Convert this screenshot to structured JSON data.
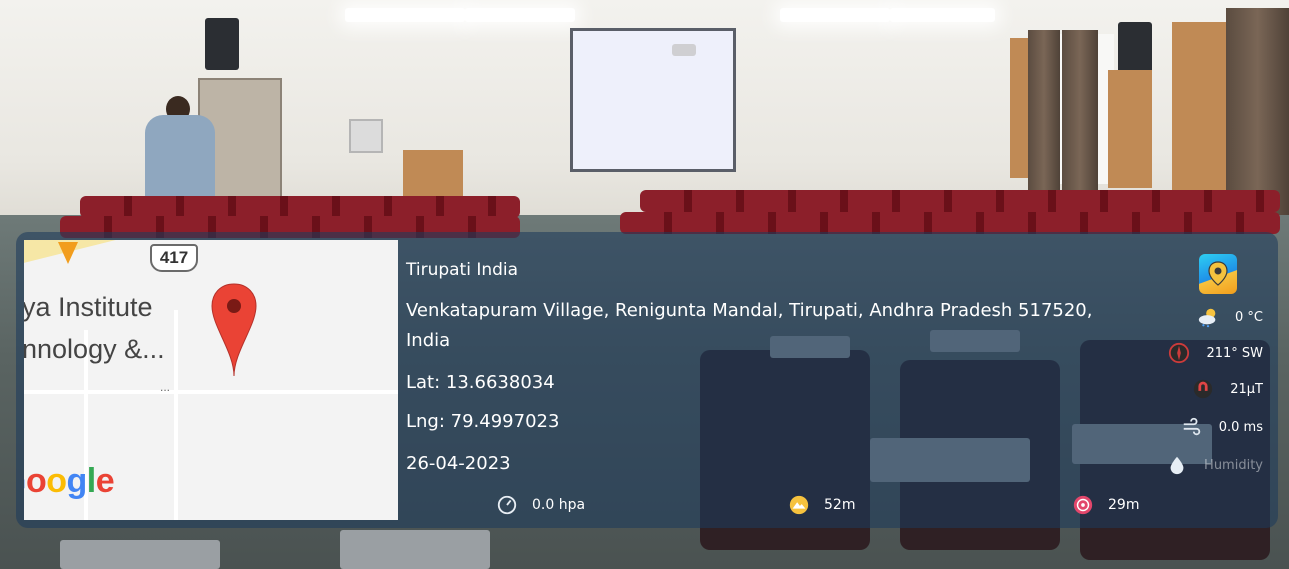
{
  "location": {
    "city_country": "Tirupati India",
    "address_line1": "Venkatapuram Village, Renigunta Mandal, Tirupati, Andhra Pradesh 517520,",
    "address_line2": "India",
    "lat": "Lat: 13.6638034",
    "lng": "Lng: 79.4997023",
    "date": "26-04-2023"
  },
  "map": {
    "route_shield": "417",
    "place_label_1": "ya Institute",
    "place_label_2": "nnology &...",
    "ellipsis": "...",
    "logo_text": "Google",
    "logo_colors": [
      "#4285F4",
      "#EA4335",
      "#FBBC05",
      "#4285F4",
      "#34A853",
      "#EA4335"
    ],
    "pin_color": "#EA4335"
  },
  "weather": {
    "temperature": "0 °C",
    "wind_direction": "211° SW",
    "magnetic": "21μT",
    "wind_speed": "0.0 ms",
    "humidity_label": "Humidity"
  },
  "footer": {
    "pressure": "0.0 hpa",
    "altitude": "52m",
    "accuracy": "29m"
  },
  "icons": {
    "app": "gps-map-camera-icon",
    "cloud": "cloud-sun-icon",
    "compass": "compass-icon",
    "magnet": "magnet-icon",
    "wind": "wind-icon",
    "humidity": "humidity-drop-icon",
    "pressure": "pressure-gauge-icon",
    "altitude": "altitude-icon",
    "accuracy": "accuracy-target-icon"
  }
}
